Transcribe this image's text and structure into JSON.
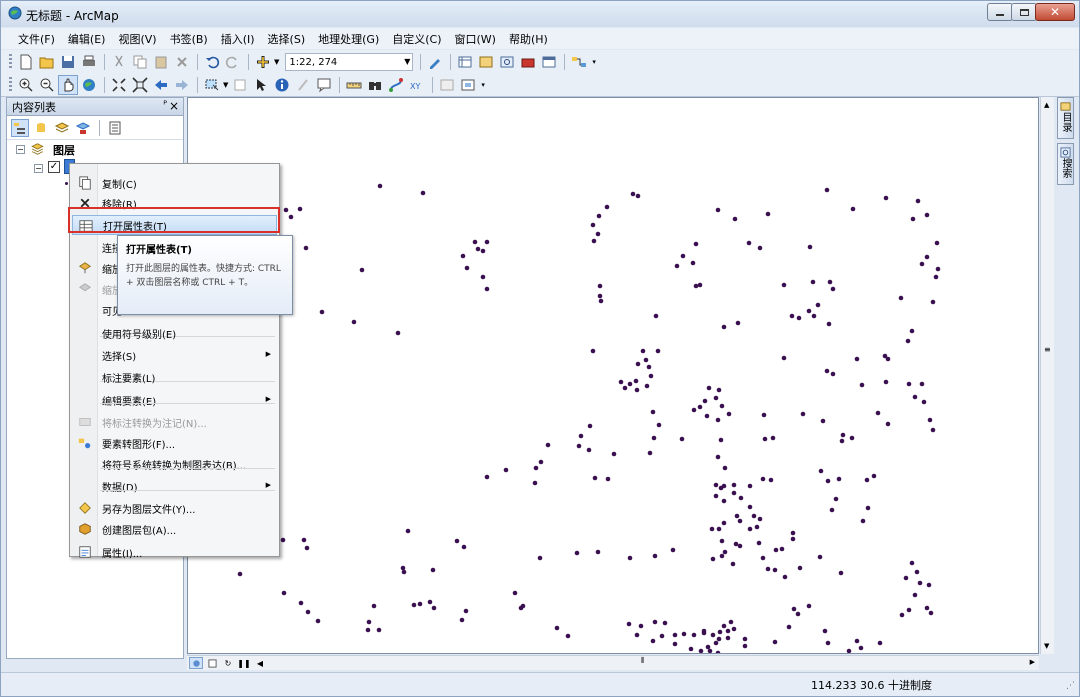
{
  "window": {
    "title": "无标题 - ArcMap"
  },
  "menubar": [
    "文件(F)",
    "编辑(E)",
    "视图(V)",
    "书签(B)",
    "插入(I)",
    "选择(S)",
    "地理处理(G)",
    "自定义(C)",
    "窗口(W)",
    "帮助(H)"
  ],
  "toolbar": {
    "scale_value": "1:22, 274"
  },
  "toc": {
    "title": "内容列表",
    "pin_label": "ᴾ",
    "close_label": "×",
    "layers_group_label": "图层"
  },
  "context_menu": {
    "items": [
      {
        "label": "复制(C)",
        "icon": "copy-icon",
        "enabled": true
      },
      {
        "label": "移除(R)",
        "icon": "remove-icon",
        "enabled": true
      },
      {
        "label": "打开属性表(T)",
        "icon": "table-icon",
        "enabled": true,
        "highlighted": true
      },
      {
        "label": "连接",
        "icon": "",
        "enabled": true
      },
      {
        "label": "缩放",
        "icon": "zoom-layer-icon",
        "enabled": true
      },
      {
        "label": "缩放",
        "icon": "zoom-visible-icon",
        "enabled": false
      },
      {
        "label": "可见",
        "icon": "",
        "enabled": true
      },
      {
        "label": "使用符号级别(E)",
        "icon": "",
        "enabled": true
      },
      {
        "label": "选择(S)",
        "icon": "",
        "enabled": true,
        "submenu": true
      },
      {
        "label": "标注要素(L)",
        "icon": "",
        "enabled": true
      },
      {
        "label": "编辑要素(E)",
        "icon": "",
        "enabled": true,
        "submenu": true
      },
      {
        "label": "将标注转换为注记(N)...",
        "icon": "convert-label-icon",
        "enabled": false
      },
      {
        "label": "要素转图形(F)...",
        "icon": "features-to-graphics-icon",
        "enabled": true
      },
      {
        "label": "将符号系统转换为制图表达(B)...",
        "icon": "",
        "enabled": true
      },
      {
        "label": "数据(D)",
        "icon": "",
        "enabled": true,
        "submenu": true
      },
      {
        "label": "另存为图层文件(Y)...",
        "icon": "layer-file-icon",
        "enabled": true
      },
      {
        "label": "创建图层包(A)...",
        "icon": "layer-package-icon",
        "enabled": true
      },
      {
        "label": "属性(I)...",
        "icon": "properties-icon",
        "enabled": true
      }
    ]
  },
  "tooltip": {
    "title": "打开属性表(T)",
    "body": "打开此图层的属性表。快捷方式: CTRL + 双击图层名称或 CTRL + T。"
  },
  "right_dock": [
    {
      "label": "目录"
    },
    {
      "label": "搜索"
    }
  ],
  "status": {
    "coordinates": "114.233  30.6 十进制度"
  },
  "colors": {
    "point_fill": "#3a1050",
    "highlight_border": "#d9302a",
    "menu_highlight": "#c4dcf6"
  }
}
